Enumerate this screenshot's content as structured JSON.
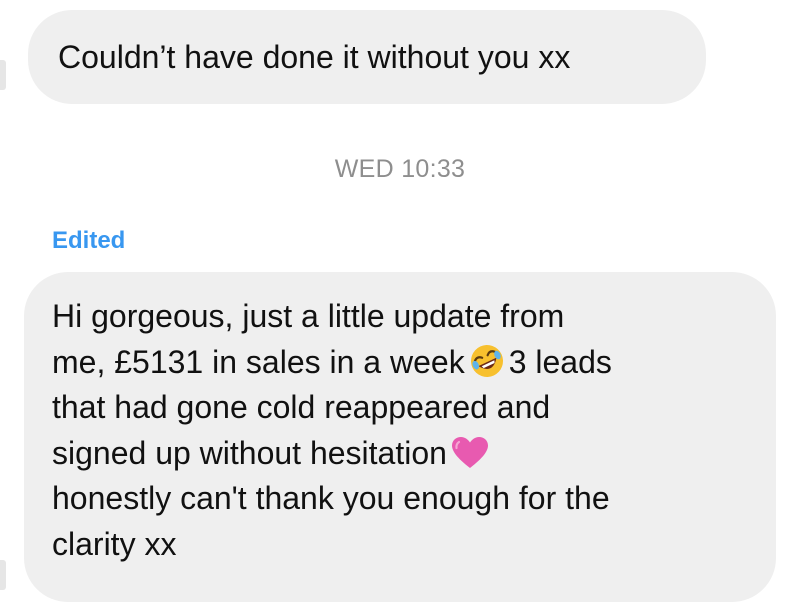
{
  "messages": [
    {
      "text": "Couldn’t have done it without you xx"
    }
  ],
  "timestamp": "WED 10:33",
  "edited_label": "Edited",
  "main_message": {
    "line1": "Hi gorgeous, just a little update from",
    "line2a": "me, £5131 in sales in a week",
    "emoji1": "rolling-on-floor-laughing-emoji",
    "line2b": "3 leads",
    "line3": "that had gone cold reappeared and",
    "line4": "signed up without hesitation",
    "emoji2": "pink-heart-emoji",
    "line5": "honestly can't thank you enough for the",
    "line6": "clarity xx"
  },
  "colors": {
    "bubble": "#efefef",
    "timestamp": "#8e8e8e",
    "edited": "#3897f0",
    "heart": "#e85ab0",
    "emoji_face": "#f7c02e"
  }
}
